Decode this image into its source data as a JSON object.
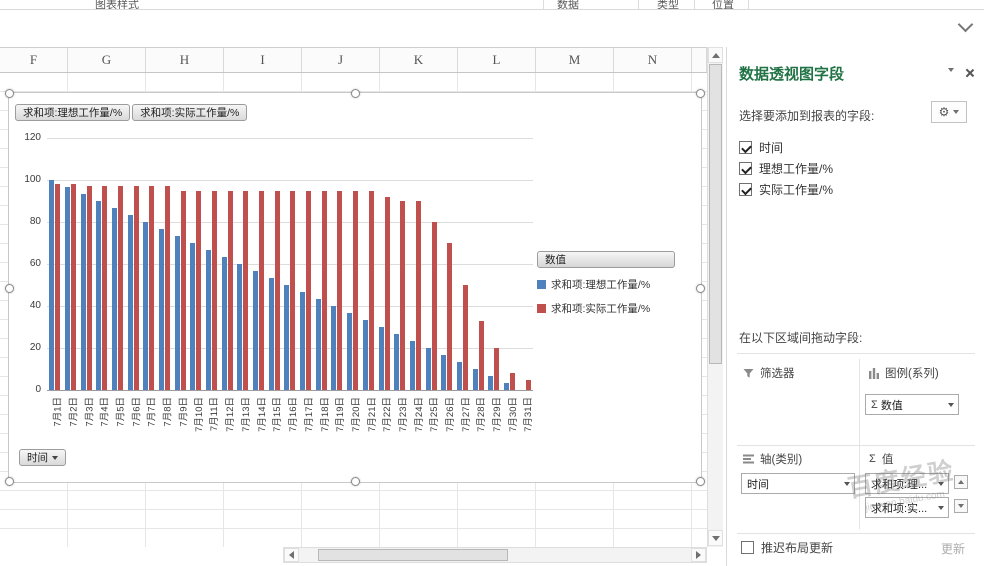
{
  "ribbon": {
    "group_labels": [
      "图表样式",
      "数据",
      "类型",
      "位置"
    ]
  },
  "grid": {
    "column_letters": [
      "F",
      "G",
      "H",
      "I",
      "J",
      "K",
      "L",
      "M",
      "N"
    ]
  },
  "chart": {
    "series_buttons": [
      "求和项:理想工作量/%",
      "求和项:实际工作量/%"
    ],
    "legend_title": "数值",
    "axis_field_button": "时间"
  },
  "chart_data": {
    "type": "bar",
    "title": "",
    "categories": [
      "7月1日",
      "7月2日",
      "7月3日",
      "7月4日",
      "7月5日",
      "7月6日",
      "7月7日",
      "7月8日",
      "7月9日",
      "7月10日",
      "7月11日",
      "7月12日",
      "7月13日",
      "7月14日",
      "7月15日",
      "7月16日",
      "7月17日",
      "7月18日",
      "7月19日",
      "7月20日",
      "7月21日",
      "7月22日",
      "7月23日",
      "7月24日",
      "7月25日",
      "7月26日",
      "7月27日",
      "7月28日",
      "7月29日",
      "7月30日",
      "7月31日"
    ],
    "series": [
      {
        "name": "求和项:理想工作量/%",
        "color": "#4F81BD",
        "values": [
          100,
          96.7,
          93.3,
          90,
          86.7,
          83.3,
          80,
          76.7,
          73.3,
          70,
          66.7,
          63.3,
          60,
          56.7,
          53.3,
          50,
          46.7,
          43.3,
          40,
          36.7,
          33.3,
          30,
          26.7,
          23.3,
          20,
          16.7,
          13.3,
          10,
          6.7,
          3.3,
          0
        ]
      },
      {
        "name": "求和项:实际工作量/%",
        "color": "#C0504D",
        "values": [
          98,
          98,
          97,
          97,
          97,
          97,
          97,
          97,
          95,
          95,
          95,
          95,
          95,
          95,
          95,
          95,
          95,
          95,
          95,
          95,
          95,
          92,
          90,
          90,
          80,
          70,
          50,
          33,
          20,
          8,
          5
        ]
      }
    ],
    "xlabel": "",
    "ylabel": "",
    "ylim": [
      0,
      120
    ],
    "yticks": [
      0,
      20,
      40,
      60,
      80,
      100,
      120
    ],
    "grid": true,
    "legend_position": "right"
  },
  "pane": {
    "title": "数据透视图字段",
    "subtitle": "选择要添加到报表的字段:",
    "fields": [
      {
        "label": "时间",
        "checked": true
      },
      {
        "label": "理想工作量/%",
        "checked": true
      },
      {
        "label": "实际工作量/%",
        "checked": true
      }
    ],
    "drag_label": "在以下区域间拖动字段:",
    "areas": {
      "filters": {
        "label": "筛选器",
        "items": []
      },
      "legend": {
        "label": "图例(系列)",
        "items": [
          "数值"
        ]
      },
      "axis": {
        "label": "轴(类别)",
        "items": [
          "时间"
        ]
      },
      "values": {
        "label": "值",
        "items": [
          "求和项:理...",
          "求和项:实..."
        ]
      }
    },
    "defer_label": "推迟布局更新",
    "update_button": "更新"
  },
  "watermark": {
    "line1": "百度经验",
    "line2": "jingyan.baidu.com"
  }
}
